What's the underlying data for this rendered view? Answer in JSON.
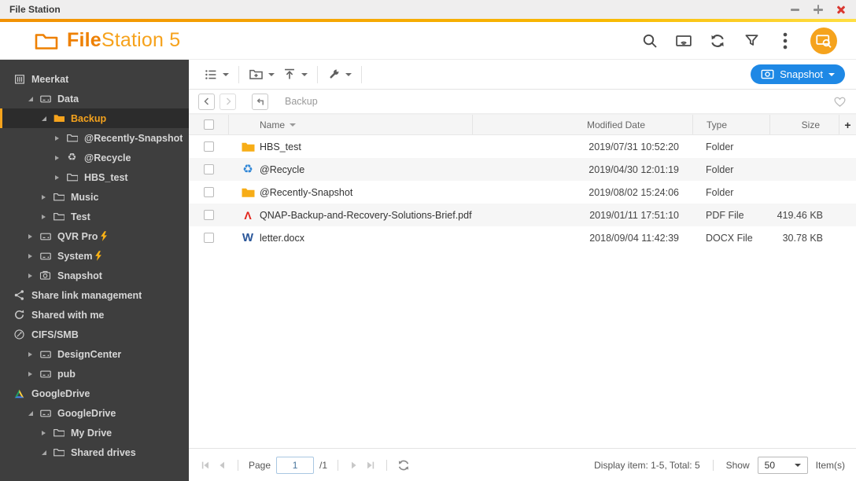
{
  "window": {
    "title": "File Station",
    "controls": [
      "minimize",
      "maximize",
      "close"
    ]
  },
  "header": {
    "logo_bold": "File",
    "logo_rest": "Station 5",
    "icons": [
      "search",
      "cast-display",
      "refresh",
      "filter",
      "more-options",
      "remote-view-badge"
    ],
    "accent_color": "#f08300"
  },
  "sidebar": {
    "items": [
      {
        "label": "Meerkat",
        "level": 0,
        "icon": "nas",
        "arrow": "none"
      },
      {
        "label": "Data",
        "level": 1,
        "icon": "drive",
        "arrow": "expanded"
      },
      {
        "label": "Backup",
        "level": 2,
        "icon": "folder-filled",
        "arrow": "expanded",
        "selected": true
      },
      {
        "label": "@Recently-Snapshot",
        "level": 3,
        "icon": "folder",
        "arrow": "collapsed"
      },
      {
        "label": "@Recycle",
        "level": 3,
        "icon": "recycle",
        "arrow": "collapsed"
      },
      {
        "label": "HBS_test",
        "level": 3,
        "icon": "folder",
        "arrow": "collapsed"
      },
      {
        "label": "Music",
        "level": 2,
        "icon": "folder",
        "arrow": "collapsed"
      },
      {
        "label": "Test",
        "level": 2,
        "icon": "folder",
        "arrow": "collapsed"
      },
      {
        "label": "QVR Pro",
        "level": 1,
        "icon": "drive",
        "arrow": "collapsed",
        "bolt": true
      },
      {
        "label": "System",
        "level": 1,
        "icon": "drive",
        "arrow": "collapsed",
        "bolt": true
      },
      {
        "label": "Snapshot",
        "level": 1,
        "icon": "camera",
        "arrow": "collapsed"
      },
      {
        "label": "Share link management",
        "level": 0,
        "icon": "share",
        "arrow": "none"
      },
      {
        "label": "Shared with me",
        "level": 0,
        "icon": "sync",
        "arrow": "none"
      },
      {
        "label": "CIFS/SMB",
        "level": 0,
        "icon": "globe",
        "arrow": "none"
      },
      {
        "label": "DesignCenter",
        "level": 1,
        "icon": "drive",
        "arrow": "collapsed"
      },
      {
        "label": "pub",
        "level": 1,
        "icon": "drive",
        "arrow": "collapsed"
      },
      {
        "label": "GoogleDrive",
        "level": 0,
        "icon": "gdrive",
        "arrow": "none"
      },
      {
        "label": "GoogleDrive",
        "level": 1,
        "icon": "drive",
        "arrow": "expanded"
      },
      {
        "label": "My Drive",
        "level": 2,
        "icon": "folder",
        "arrow": "collapsed"
      },
      {
        "label": "Shared drives",
        "level": 2,
        "icon": "folder",
        "arrow": "expanded"
      }
    ]
  },
  "toolbar": {
    "buttons": [
      "view-mode",
      "create-folder",
      "upload",
      "tools"
    ],
    "snapshot_label": "Snapshot",
    "snapshot_color": "#1e88e5"
  },
  "breadcrumb": {
    "path": "Backup"
  },
  "table": {
    "columns": {
      "name": "Name",
      "modified": "Modified Date",
      "type": "Type",
      "size": "Size",
      "add": "+"
    },
    "rows": [
      {
        "name": "HBS_test",
        "icon": "folder",
        "modified": "2019/07/31 10:52:20",
        "type": "Folder",
        "size": ""
      },
      {
        "name": "@Recycle",
        "icon": "recycle",
        "modified": "2019/04/30 12:01:19",
        "type": "Folder",
        "size": ""
      },
      {
        "name": "@Recently-Snapshot",
        "icon": "folder",
        "modified": "2019/08/02 15:24:06",
        "type": "Folder",
        "size": ""
      },
      {
        "name": "QNAP-Backup-and-Recovery-Solutions-Brief.pdf",
        "icon": "pdf",
        "modified": "2019/01/11 17:51:10",
        "type": "PDF File",
        "size": "419.46 KB"
      },
      {
        "name": "letter.docx",
        "icon": "word",
        "modified": "2018/09/04 11:42:39",
        "type": "DOCX File",
        "size": "30.78 KB"
      }
    ]
  },
  "footer": {
    "page_label": "Page",
    "page_value": "1",
    "page_total": "/1",
    "display_text": "Display item: 1-5, Total: 5",
    "show_label": "Show",
    "show_value": "50",
    "items_label": "Item(s)"
  },
  "colors": {
    "accent_orange": "#f5a31d",
    "snapshot_blue": "#1e88e5",
    "sidebar_bg": "#3e3e3e",
    "folder_yellow": "#f7ad17",
    "pdf_red": "#e2231a",
    "word_blue": "#2b579a",
    "recycle_blue": "#2f86d6"
  }
}
